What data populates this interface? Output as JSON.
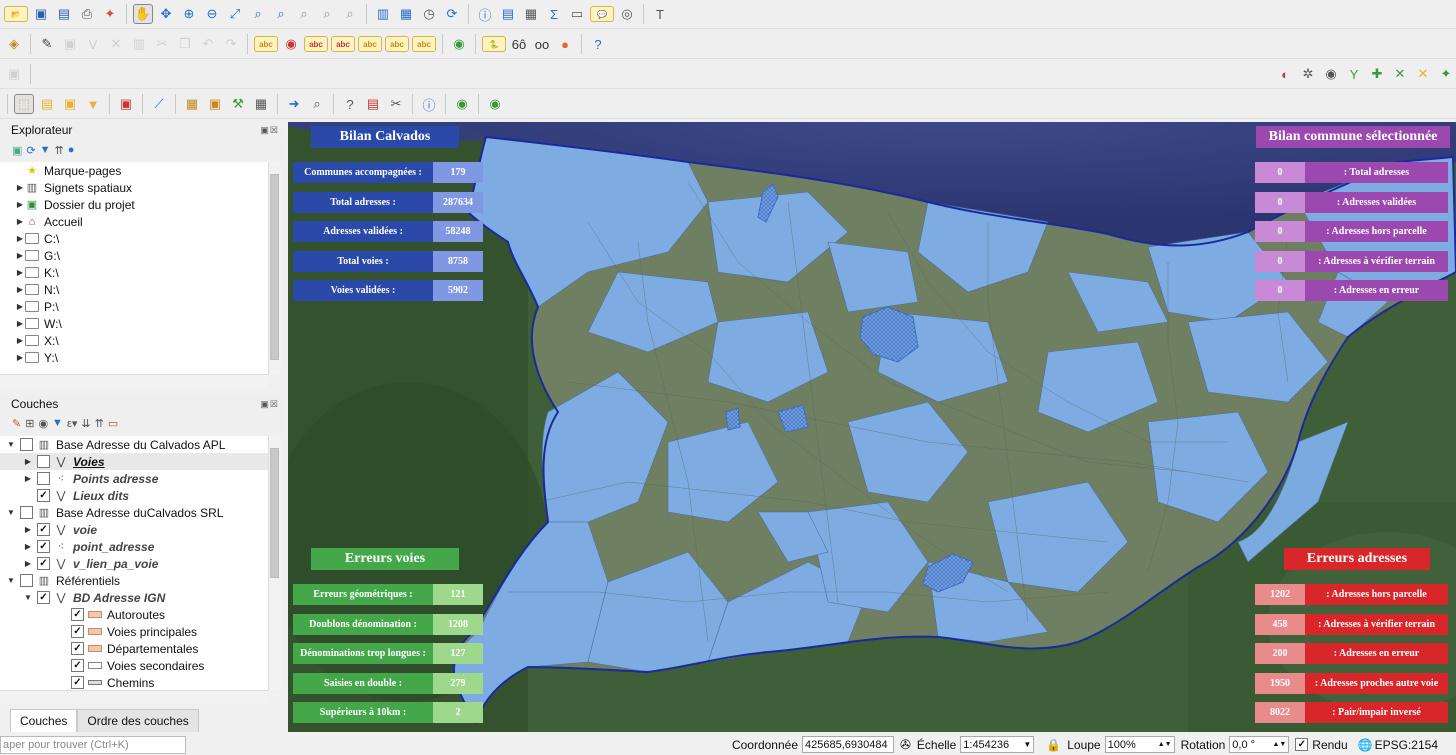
{
  "toolbar1": [
    "folder-open-icon",
    "save-icon",
    "save-as-icon",
    "print-layout-icon",
    "style-manager-icon",
    "pan-hand-icon",
    "pan-selection-icon",
    "zoom-in-icon",
    "zoom-out-icon",
    "zoom-full-icon",
    "zoom-layer-icon",
    "zoom-selection-icon",
    "zoom-last-icon",
    "zoom-next-icon",
    "zoom-native-icon",
    "new-bookmark-icon",
    "show-bookmarks-icon",
    "temporal-icon",
    "refresh-icon",
    "identify-icon",
    "attribute-table-icon",
    "field-calculator-icon",
    "sum-icon",
    "measure-icon",
    "map-tips-icon",
    "annotation-icon",
    "text-annotation-icon"
  ],
  "toolbar2": [
    "digitize-icon",
    "pencil-icon",
    "save-edits-icon",
    "add-feature-icon",
    "vertex-tool-icon",
    "delete-icon",
    "cut-icon",
    "copy-icon",
    "undo-icon",
    "redo-icon",
    "label-icon",
    "label-pin-icon",
    "label-show-icon",
    "label-move-icon",
    "label-rotate-icon",
    "label-change-icon",
    "label-diagram-icon",
    "globe-icon",
    "python-icon",
    "plugin-icon",
    "plugin-icon-2",
    "ref-icon",
    "help-icon"
  ],
  "toolbar3": [
    "advanced-digitize-icon",
    "snap-magnet-icon",
    "topology-icon",
    "eye-icon",
    "tracing-icon",
    "avoid-overlap-icon",
    "segment-icon",
    "cross-icon",
    "pin-icon"
  ],
  "toolbar4": [
    "select-feature-icon",
    "deselect-icon",
    "select-value-icon",
    "select-location-icon",
    "form-select-icon",
    "measure-line-icon",
    "chart-icon",
    "package-icon",
    "cube-icon",
    "tools-icon",
    "database-icon",
    "arrow-icon",
    "search-icon",
    "help-tool-icon",
    "report-icon",
    "scissors-icon",
    "help-circle-icon",
    "share-icon"
  ],
  "explorer": {
    "title": "Explorateur",
    "items": [
      "Marque-pages",
      "Signets spatiaux",
      "Dossier du projet",
      "Accueil",
      "C:\\",
      "G:\\",
      "K:\\",
      "N:\\",
      "P:\\",
      "W:\\",
      "X:\\",
      "Y:\\"
    ]
  },
  "layers": {
    "title": "Couches",
    "items": [
      {
        "label": "Base Adresse du Calvados APL",
        "depth": 0,
        "arrow": "▼",
        "checked": false,
        "style": "normal",
        "icon": "group"
      },
      {
        "label": "Voies",
        "depth": 1,
        "arrow": "▶",
        "checked": false,
        "style": "bold-underline",
        "icon": "line"
      },
      {
        "label": "Points adresse",
        "depth": 1,
        "arrow": "▶",
        "checked": false,
        "style": "italic",
        "icon": "point"
      },
      {
        "label": "Lieux dits",
        "depth": 1,
        "arrow": "",
        "checked": true,
        "style": "italic",
        "icon": "line"
      },
      {
        "label": "Base Adresse duCalvados SRL",
        "depth": 0,
        "arrow": "▼",
        "checked": false,
        "style": "normal",
        "icon": "group"
      },
      {
        "label": "voie",
        "depth": 1,
        "arrow": "▶",
        "checked": true,
        "style": "italic",
        "icon": "line"
      },
      {
        "label": "point_adresse",
        "depth": 1,
        "arrow": "▶",
        "checked": true,
        "style": "italic",
        "icon": "point"
      },
      {
        "label": "v_lien_pa_voie",
        "depth": 1,
        "arrow": "▶",
        "checked": true,
        "style": "italic",
        "icon": "line"
      },
      {
        "label": "Référentiels",
        "depth": 0,
        "arrow": "▼",
        "checked": false,
        "style": "normal",
        "icon": "group"
      },
      {
        "label": "BD Adresse IGN",
        "depth": 1,
        "arrow": "▼",
        "checked": true,
        "style": "italic",
        "icon": "line"
      },
      {
        "label": "Autoroutes",
        "depth": 3,
        "arrow": "",
        "checked": true,
        "style": "normal",
        "icon": "road"
      },
      {
        "label": "Voies principales",
        "depth": 3,
        "arrow": "",
        "checked": true,
        "style": "normal",
        "icon": "road"
      },
      {
        "label": "Départementales",
        "depth": 3,
        "arrow": "",
        "checked": true,
        "style": "normal",
        "icon": "road"
      },
      {
        "label": "Voies secondaires",
        "depth": 3,
        "arrow": "",
        "checked": true,
        "style": "normal",
        "icon": "road2"
      },
      {
        "label": "Chemins",
        "depth": 3,
        "arrow": "",
        "checked": true,
        "style": "normal",
        "icon": "road3"
      }
    ]
  },
  "tabs": [
    "Couches",
    "Ordre des couches"
  ],
  "bilan_calvados": {
    "title": "Bilan Calvados",
    "rows": [
      {
        "label": "Communes accompagnées :",
        "value": "179"
      },
      {
        "label": "Total adresses :",
        "value": "287634"
      },
      {
        "label": "Adresses validées :",
        "value": "58248"
      },
      {
        "label": "Total voies :",
        "value": "8758"
      },
      {
        "label": "Voies validées :",
        "value": "5902"
      }
    ]
  },
  "bilan_commune": {
    "title": "Bilan commune sélectionnée",
    "rows": [
      {
        "value": "0",
        "label": ": Total adresses"
      },
      {
        "value": "0",
        "label": ": Adresses validées"
      },
      {
        "value": "0",
        "label": ": Adresses hors parcelle"
      },
      {
        "value": "0",
        "label": ": Adresses à vérifier terrain"
      },
      {
        "value": "0",
        "label": ": Adresses en erreur"
      }
    ]
  },
  "erreurs_voies": {
    "title": "Erreurs voies",
    "rows": [
      {
        "label": "Erreurs géométriques :",
        "value": "121"
      },
      {
        "label": "Doublons dénomination :",
        "value": "1208"
      },
      {
        "label": "Dénominations trop longues :",
        "value": "127"
      },
      {
        "label": "Saisies en double :",
        "value": "279"
      },
      {
        "label": "Supérieurs à 10km :",
        "value": "2"
      }
    ]
  },
  "erreurs_adresses": {
    "title": "Erreurs adresses",
    "rows": [
      {
        "value": "1202",
        "label": ": Adresses hors parcelle"
      },
      {
        "value": "458",
        "label": ": Adresses à vérifier terrain"
      },
      {
        "value": "200",
        "label": ": Adresses en erreur"
      },
      {
        "value": "1950",
        "label": ": Adresses proches autre voie"
      },
      {
        "value": "8022",
        "label": ": Pair/impair inversé"
      }
    ]
  },
  "colors": {
    "blue_dark": "#2a49a8",
    "blue_light": "#8097e4",
    "purple_dark": "#9b49ae",
    "purple_light": "#c88ad6",
    "green_dark": "#44a84a",
    "green_light": "#9ed88c",
    "red_dark": "#d9262a",
    "red_light": "#ea8b8b"
  },
  "status": {
    "search_placeholder": "aper pour trouver (Ctrl+K)",
    "coord_label": "Coordonnée",
    "coord_value": "425685,6930484",
    "scale_label": "Échelle",
    "scale_value": "1:454236",
    "magnifier_label": "Loupe",
    "magnifier_value": "100%",
    "rotation_label": "Rotation",
    "rotation_value": "0,0 °",
    "render_label": "Rendu",
    "crs": "EPSG:2154"
  }
}
